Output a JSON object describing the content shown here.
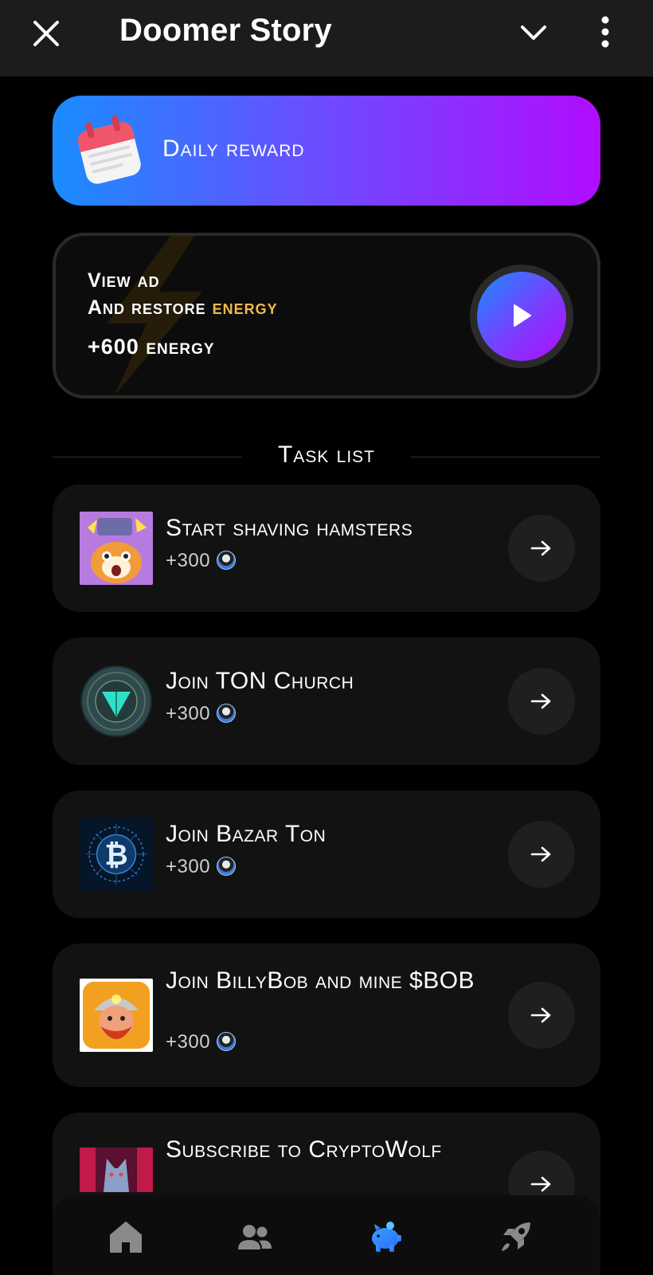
{
  "header": {
    "title": "Doomer Story"
  },
  "daily_reward": {
    "label": "Daily reward"
  },
  "ad_card": {
    "line1": "View ad",
    "line2_prefix": "And restore ",
    "line2_highlight": "energy",
    "reward": "+600 energy"
  },
  "task_list": {
    "title": "Task list",
    "tasks": [
      {
        "name": "Start shaving hamsters",
        "reward": "+300"
      },
      {
        "name": "Join TON Church",
        "reward": "+300"
      },
      {
        "name": "Join Bazar Ton",
        "reward": "+300"
      },
      {
        "name": "Join BillyBob and mine $BOB",
        "reward": "+300"
      },
      {
        "name": "Subscribe to CryptoWolf",
        "reward": ""
      }
    ]
  },
  "nav": {
    "items": [
      "home-icon",
      "friends-icon",
      "piggy-bank-icon",
      "rocket-icon"
    ],
    "active": "piggy-bank-icon"
  },
  "colors": {
    "accent_blue": "#1a8cff",
    "accent_purple": "#b10cff",
    "energy": "#f2b84b"
  }
}
